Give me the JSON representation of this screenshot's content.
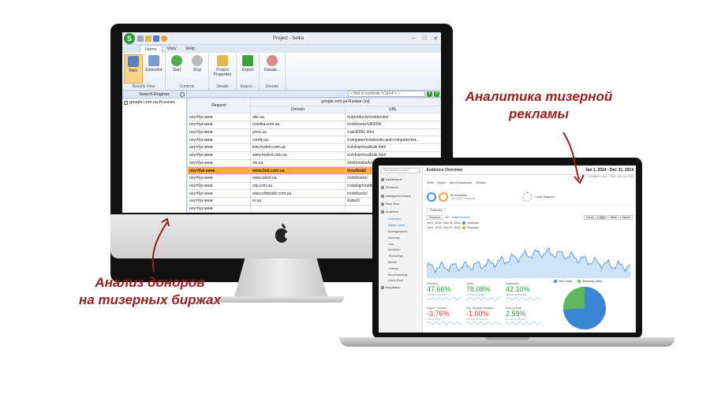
{
  "annotations": {
    "left_line1": "Анализ доноров",
    "left_line2": "на тизерных биржах",
    "right_line1": "Аналитика тизерной",
    "right_line2": "рекламы"
  },
  "colors": {
    "annotation": "#9b1c1c",
    "highlight_row": "#f7a84a",
    "ga_blue": "#4a90d9",
    "ga_orange": "#f0a33a",
    "ga_green": "#2e9b3a",
    "ga_red": "#d23c2c"
  },
  "selka": {
    "logo_letter": "S",
    "window_title": "Project - Selka",
    "win_controls": [
      "–",
      "□",
      "✕"
    ],
    "menu_tabs": [
      "Home",
      "View",
      "Help"
    ],
    "ribbon": {
      "groups": [
        {
          "name": "Results View",
          "buttons": [
            "Main",
            "Extended"
          ]
        },
        {
          "name": "Controls",
          "buttons": [
            "Start",
            "Stop"
          ]
        },
        {
          "name": "Details",
          "buttons": [
            "Project Properties"
          ]
        },
        {
          "name": "Export...",
          "buttons": [
            "Export"
          ]
        },
        {
          "name": "Donate",
          "buttons": [
            "Donate..."
          ]
        }
      ]
    },
    "left_pane": {
      "header": "Search Engines",
      "engine": "google.com.ua-Russian"
    },
    "search": {
      "placeholder": "« find in contents <Ctrl+F> »"
    },
    "table": {
      "group_header": "google.com.ua-Russian [ru]",
      "col_request": "Request",
      "col_domain": "Domain",
      "col_url": "URL",
      "rows": [
        {
          "request": "ноутбук киев",
          "domain": "allo.ua",
          "url": "/ru/products/notebooks/"
        },
        {
          "request": "ноутбук киев",
          "domain": "rozetka.com.ua",
          "url": "/notebooks/c80004/"
        },
        {
          "request": "ноутбук киев",
          "domain": "price.ua",
          "url": "/catc839t1.html"
        },
        {
          "request": "ноутбук киев",
          "domain": "comfy.ua",
          "url": "/computer/notebooks-and-computer/not..."
        },
        {
          "request": "ноутбук киев",
          "domain": "kiev.foxtrot.com.ua",
          "url": "/ru/shop/noutbuki.html"
        },
        {
          "request": "ноутбук киев",
          "domain": "www.foxtrot.com.ua",
          "url": "/ru/shop/noutbuki.html"
        },
        {
          "request": "ноутбук киев",
          "domain": "olx.ua",
          "url": "/elektronika/kompyutery/noutbuki/kiev/"
        },
        {
          "request": "ноутбук киев",
          "domain": "www.5ok.com.ua",
          "url": "/noutbuki/"
        },
        {
          "request": "ноутбук киев",
          "domain": "www.sokol.ua",
          "url": "/notebooks/"
        },
        {
          "request": "ноутбук киев",
          "domain": "city.com.ua",
          "url": "/catalog/noutbuki/"
        },
        {
          "request": "ноутбук киев",
          "domain": "www.eldorado.com.ua",
          "url": "/notebooks/"
        },
        {
          "request": "ноутбук киев",
          "domain": "m.ua",
          "url": "/kata/2/"
        },
        {
          "request": "ноутбук киев",
          "domain": "",
          "url": ""
        }
      ]
    }
  },
  "ga": {
    "search_placeholder": "Find reports & more",
    "nav": [
      "Dashboards",
      "Shortcuts",
      "Intelligence Events",
      "Real-Time",
      "Audience"
    ],
    "audience_sub": [
      "Overview",
      "Active Users",
      "Demographics",
      "Interests",
      "Geo",
      "Behavior",
      "Technology",
      "Mobile",
      "Custom",
      "Benchmarking",
      "Users Flow"
    ],
    "nav_bottom": "Acquisition",
    "title": "Audience Overview",
    "date_range": "Jan 1, 2014 - Dec 31, 2014",
    "compare_range": "Compare to: Jan 1, 2013 - Dec 31, 2013",
    "toolbar": [
      "Email",
      "Export",
      "Add to Dashboard",
      "Shortcut"
    ],
    "segment1": "All Sessions",
    "segment1_sub": "100.00% Sessions",
    "segment2": "+ Add Segment",
    "tab": "Overview",
    "metric_select": "Sessions",
    "vs": "VS.",
    "select_metric": "Select a metric",
    "periods": [
      "Hourly",
      "Day",
      "Week",
      "Month"
    ],
    "legend1": "Jan 1, 2014 - Dec 31, 2014:",
    "legend1_series": "Sessions",
    "legend2": "Jan 1, 2013 - Dec 31, 2013:",
    "legend2_series": "Sessions",
    "metrics": [
      {
        "label": "Sessions",
        "value": "47.66%",
        "sub": "120,462 vs 81,590",
        "trend": "up"
      },
      {
        "label": "Users",
        "value": "78.08%",
        "sub": "91,532 vs 51,404",
        "trend": "up"
      },
      {
        "label": "Pageviews",
        "value": "42.10%",
        "sub": "438,617 vs 308,666",
        "trend": "up"
      },
      {
        "label": "Pages / Session",
        "value": "-3.76%",
        "sub": "3.64 vs 3.78",
        "trend": "down"
      },
      {
        "label": "Avg. Session Duration",
        "value": "-1.00%",
        "sub": "00:02:49 vs 00:02:51",
        "trend": "down"
      },
      {
        "label": "Bounce Rate",
        "value": "2.59%",
        "sub": "47.13% vs 45.94%",
        "trend": "up"
      }
    ],
    "pie_legend": [
      "New Visitor",
      "Returning Visitor"
    ],
    "pie_share_new": 0.74
  }
}
